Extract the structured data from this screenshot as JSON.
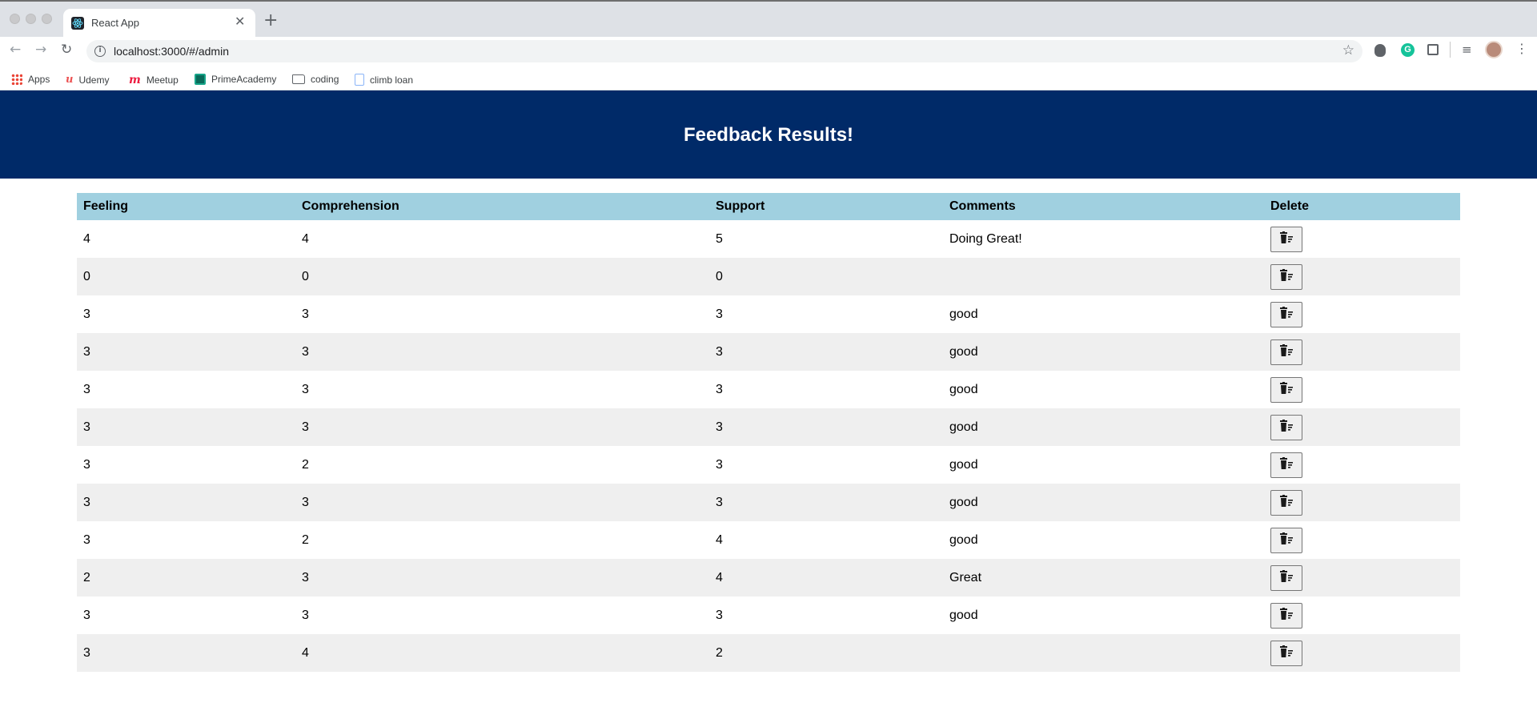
{
  "browser": {
    "tab_title": "React App",
    "tab_close": "✕",
    "new_tab": "+",
    "url": "localhost:3000/#/admin",
    "bookmarks": [
      {
        "label": "Apps",
        "icon": "apps-icon"
      },
      {
        "label": "Udemy",
        "icon": "udemy-icon"
      },
      {
        "label": "Meetup",
        "icon": "meetup-icon"
      },
      {
        "label": "PrimeAcademy",
        "icon": "primeacademy-icon"
      },
      {
        "label": "coding",
        "icon": "folder-icon"
      },
      {
        "label": "climb loan",
        "icon": "doc-icon"
      }
    ]
  },
  "app": {
    "title": "Feedback Results!",
    "colors": {
      "header_bg": "#002a68",
      "table_header_bg": "#a0d0e0",
      "stripe_bg": "#efefef"
    }
  },
  "table": {
    "headers": [
      "Feeling",
      "Comprehension",
      "Support",
      "Comments",
      "Delete"
    ],
    "rows": [
      {
        "feeling": "4",
        "comprehension": "4",
        "support": "5",
        "comments": "Doing Great!"
      },
      {
        "feeling": "0",
        "comprehension": "0",
        "support": "0",
        "comments": ""
      },
      {
        "feeling": "3",
        "comprehension": "3",
        "support": "3",
        "comments": "good"
      },
      {
        "feeling": "3",
        "comprehension": "3",
        "support": "3",
        "comments": "good"
      },
      {
        "feeling": "3",
        "comprehension": "3",
        "support": "3",
        "comments": "good"
      },
      {
        "feeling": "3",
        "comprehension": "3",
        "support": "3",
        "comments": "good"
      },
      {
        "feeling": "3",
        "comprehension": "2",
        "support": "3",
        "comments": "good"
      },
      {
        "feeling": "3",
        "comprehension": "3",
        "support": "3",
        "comments": "good"
      },
      {
        "feeling": "3",
        "comprehension": "2",
        "support": "4",
        "comments": "good"
      },
      {
        "feeling": "2",
        "comprehension": "3",
        "support": "4",
        "comments": "Great"
      },
      {
        "feeling": "3",
        "comprehension": "3",
        "support": "3",
        "comments": "good"
      },
      {
        "feeling": "3",
        "comprehension": "4",
        "support": "2",
        "comments": ""
      }
    ],
    "delete_icon": "trash-sweep-icon"
  }
}
